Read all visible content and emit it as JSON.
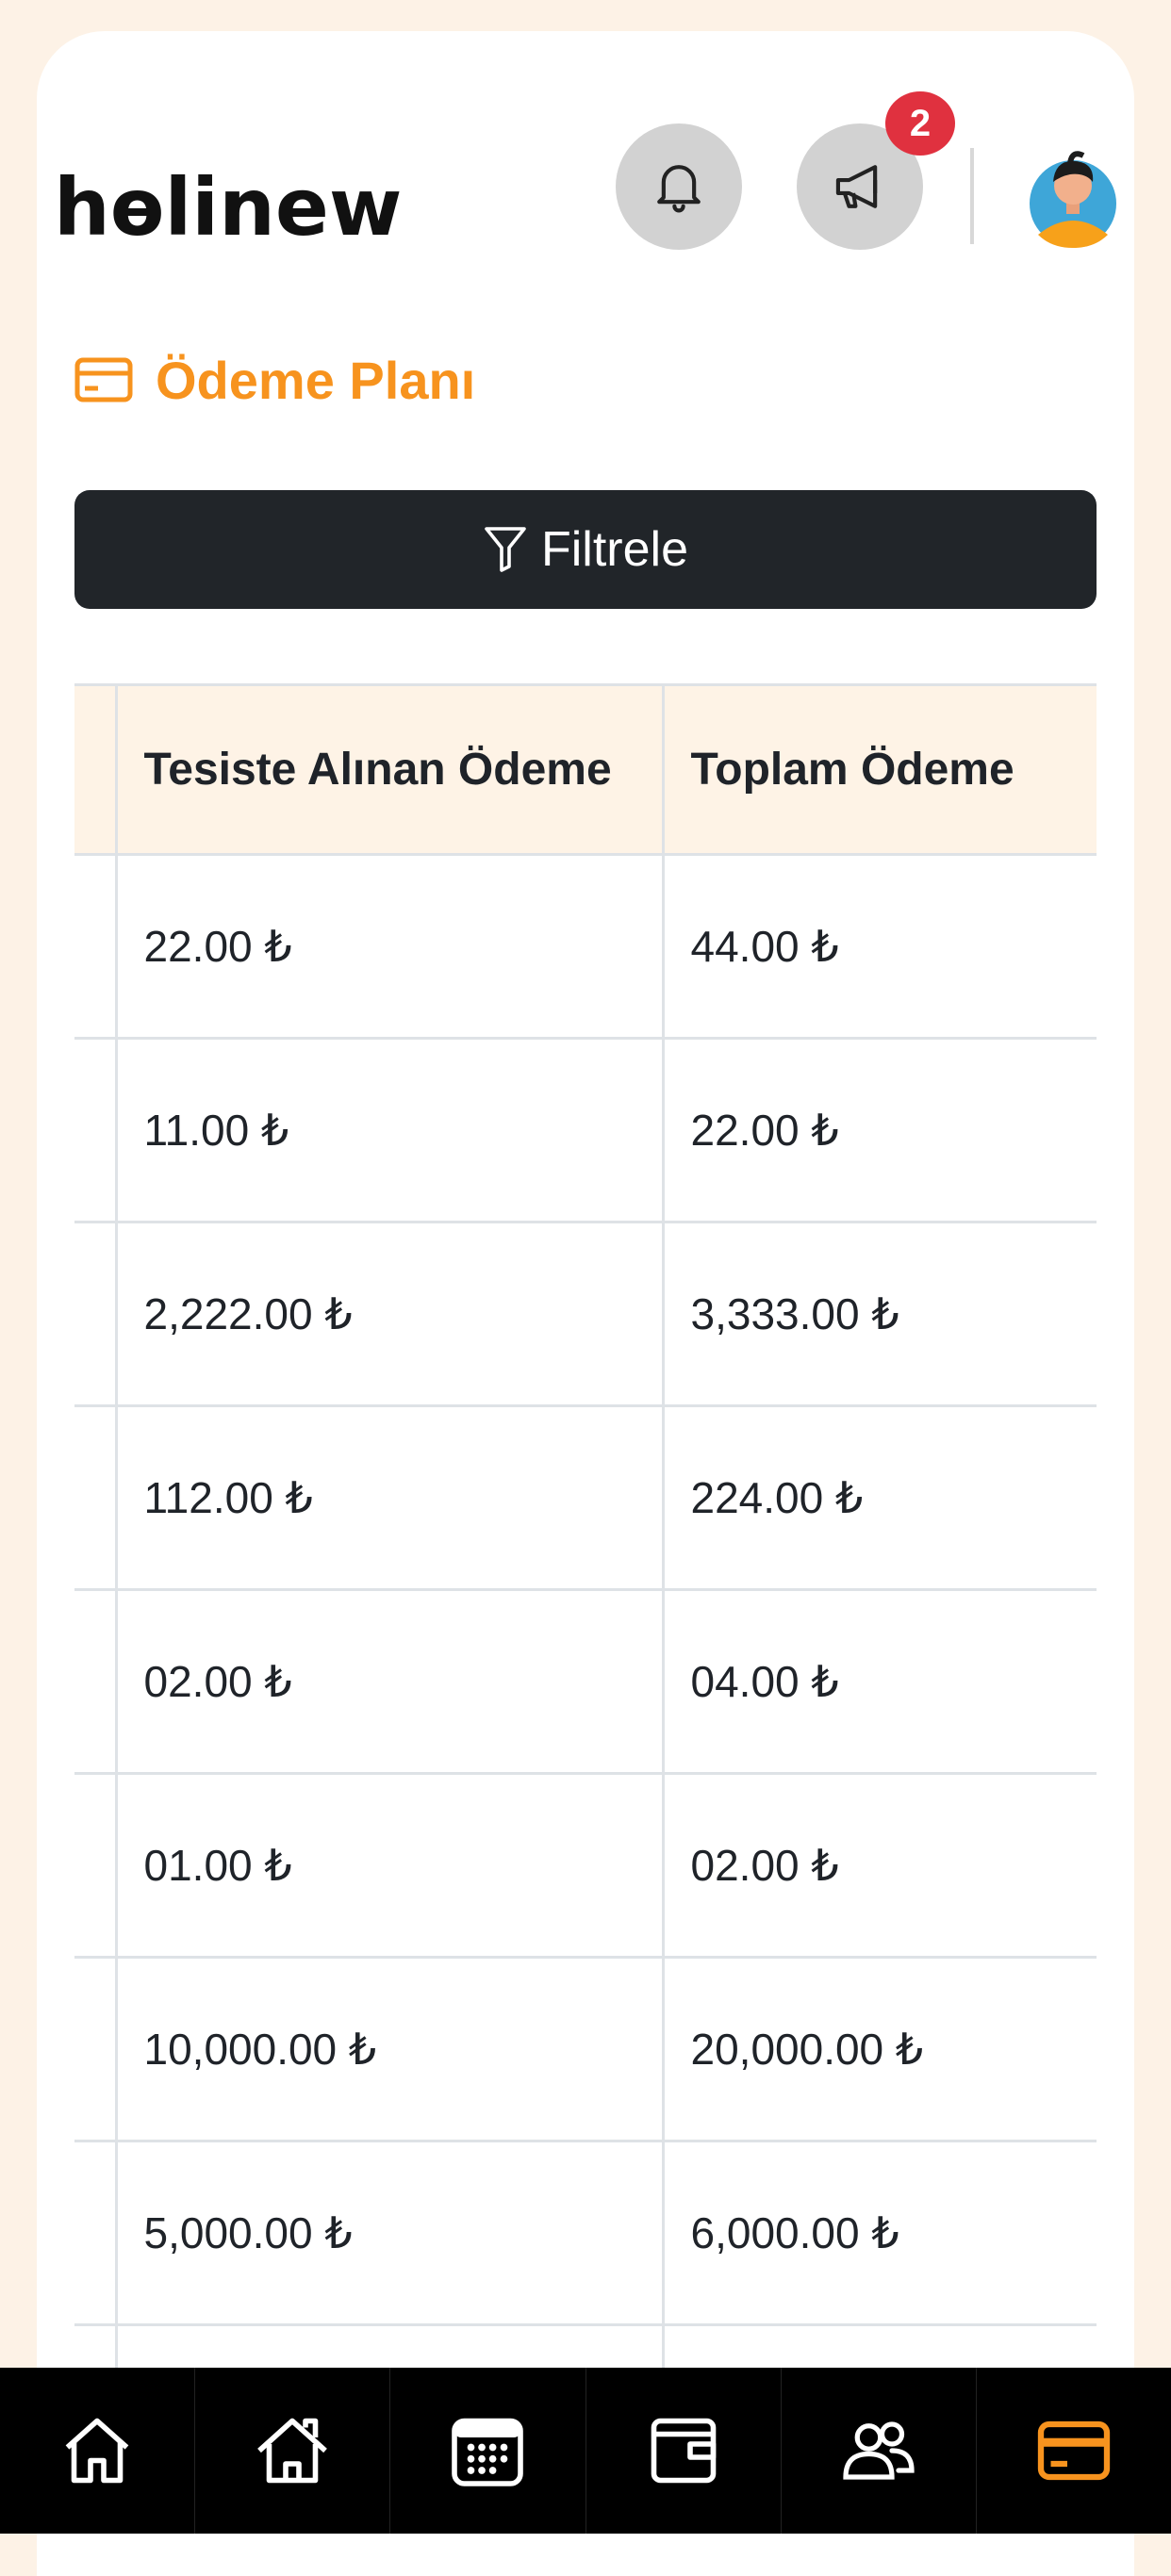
{
  "header": {
    "logo_text": "hɵlinew",
    "notification_badge": "2"
  },
  "page": {
    "title": "Ödeme Planı",
    "filter_label": "Filtrele"
  },
  "table": {
    "columns": [
      "",
      "Tesiste Alınan Ödeme",
      "Toplam Ödeme"
    ],
    "rows": [
      [
        "22.00 ₺",
        "44.00 ₺"
      ],
      [
        "11.00 ₺",
        "22.00 ₺"
      ],
      [
        "2,222.00 ₺",
        "3,333.00 ₺"
      ],
      [
        "112.00 ₺",
        "224.00 ₺"
      ],
      [
        "02.00 ₺",
        "04.00 ₺"
      ],
      [
        "01.00 ₺",
        "02.00 ₺"
      ],
      [
        "10,000.00 ₺",
        "20,000.00 ₺"
      ],
      [
        "5,000.00 ₺",
        "6,000.00 ₺"
      ]
    ]
  },
  "bottom_nav": {
    "items": [
      {
        "icon": "home-icon",
        "active": false
      },
      {
        "icon": "house-outline-icon",
        "active": false
      },
      {
        "icon": "calendar-icon",
        "active": false
      },
      {
        "icon": "wallet-icon",
        "active": false
      },
      {
        "icon": "users-icon",
        "active": false
      },
      {
        "icon": "credit-card-icon",
        "active": true
      }
    ]
  },
  "colors": {
    "accent": "#f7931e",
    "dark": "#212529",
    "badge": "#e0313f",
    "page_bg": "#fdf2e6",
    "table_header_bg": "#fef3e6"
  }
}
